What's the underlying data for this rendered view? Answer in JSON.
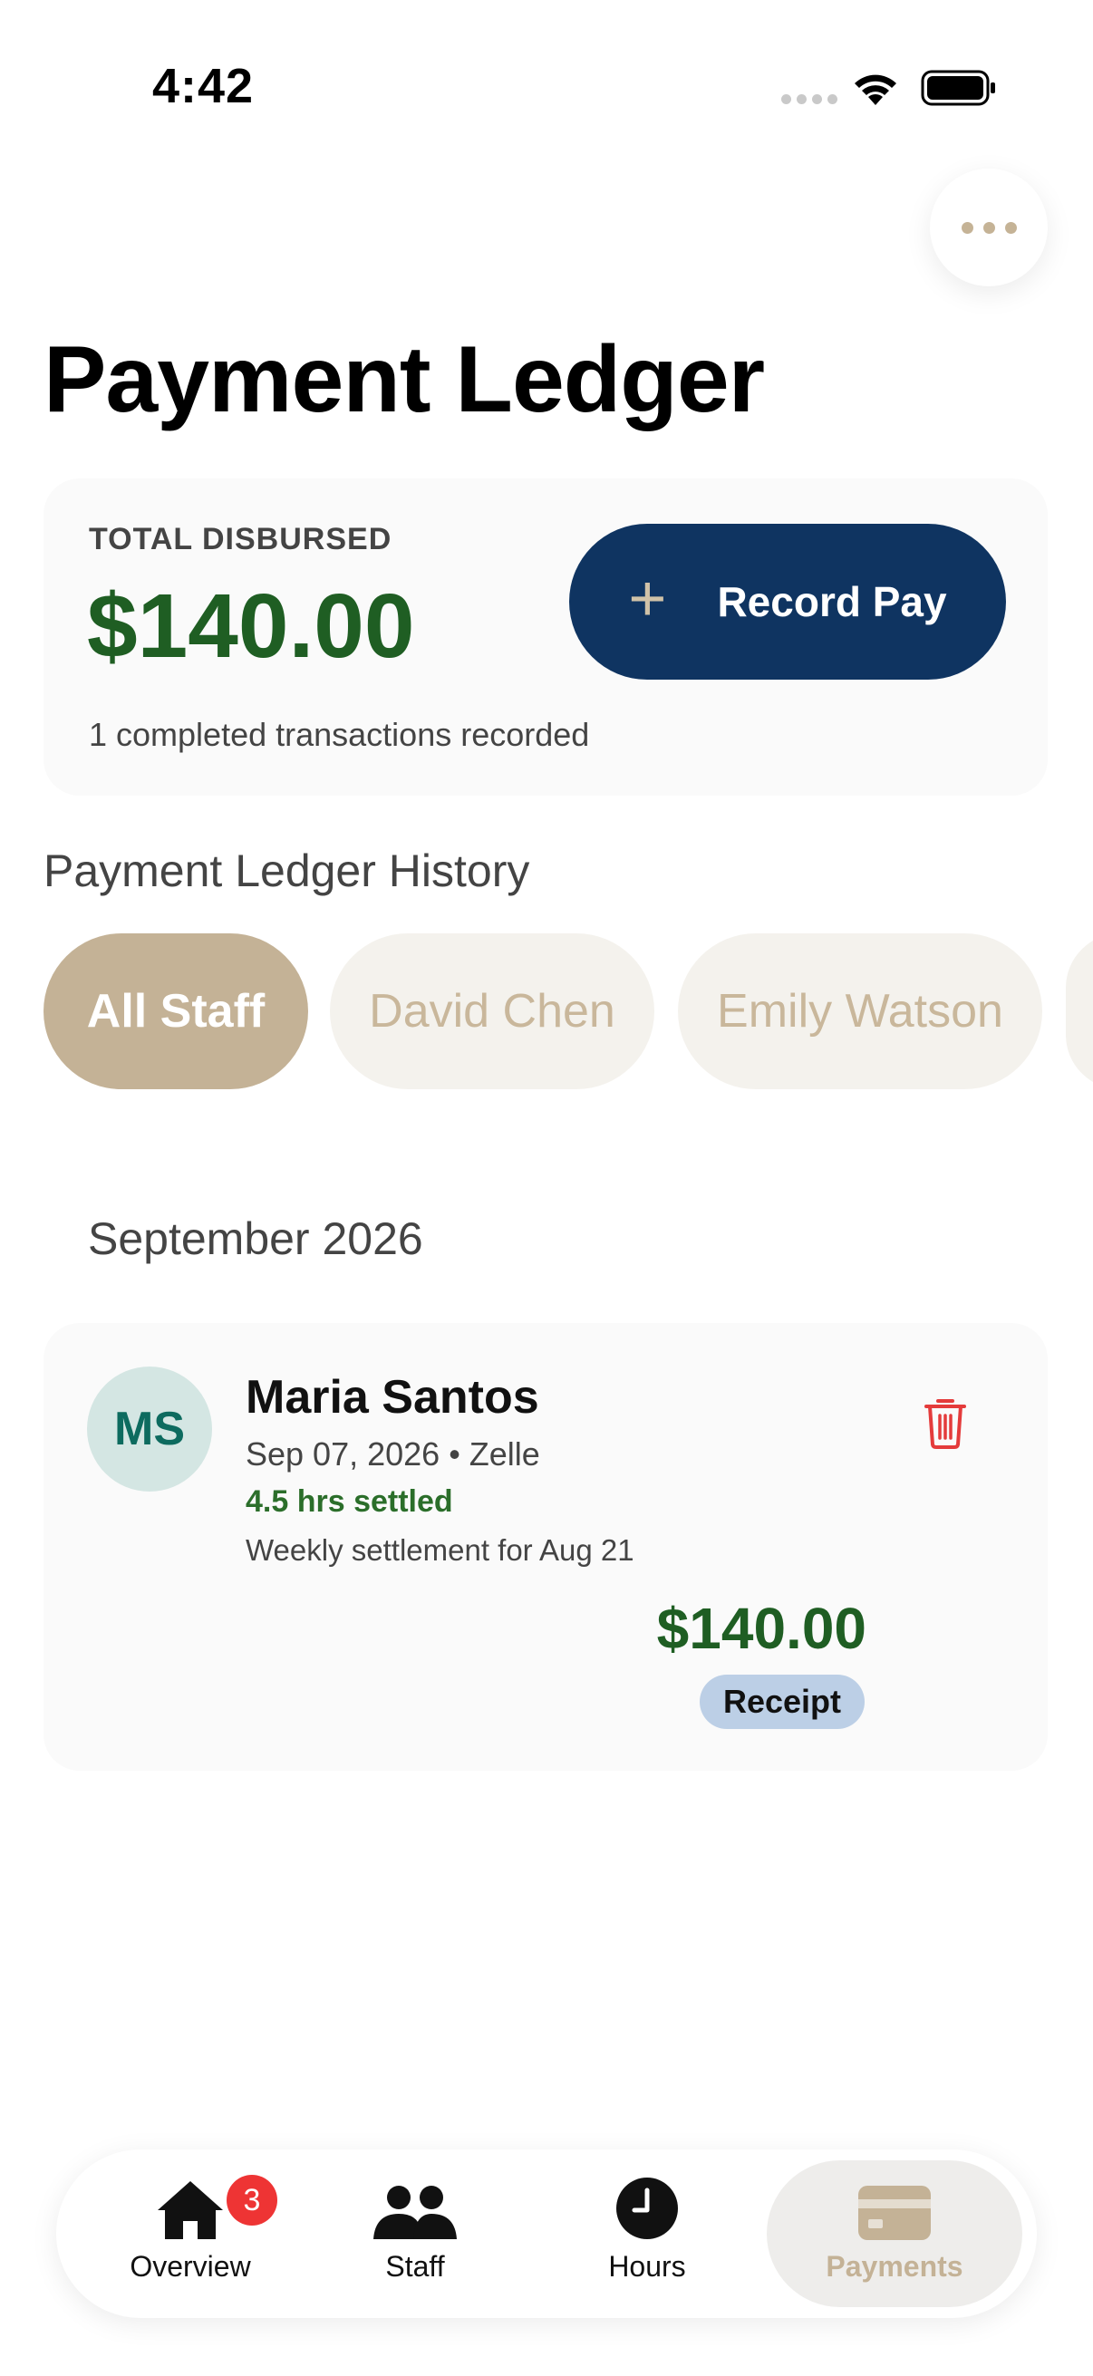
{
  "status_bar": {
    "time": "4:42"
  },
  "page": {
    "title": "Payment Ledger"
  },
  "summary": {
    "label": "TOTAL DISBURSED",
    "amount": "$140.00",
    "note": "1 completed transactions recorded",
    "record_button_label": "Record Pay"
  },
  "history": {
    "title": "Payment Ledger History",
    "filters": [
      {
        "label": "All Staff",
        "active": true
      },
      {
        "label": "David Chen",
        "active": false
      },
      {
        "label": "Emily Watson",
        "active": false
      }
    ],
    "month": "September 2026",
    "transactions": [
      {
        "initials": "MS",
        "name": "Maria Santos",
        "date": "Sep 07, 2026",
        "method": "Zelle",
        "meta": "Sep 07, 2026 • Zelle",
        "hours": "4.5 hrs settled",
        "description": "Weekly settlement for Aug 21",
        "amount": "$140.00",
        "badge": "Receipt"
      }
    ]
  },
  "tabs": [
    {
      "label": "Overview",
      "icon": "home-icon",
      "badge": "3",
      "active": false
    },
    {
      "label": "Staff",
      "icon": "people-icon",
      "active": false
    },
    {
      "label": "Hours",
      "icon": "clock-icon",
      "active": false
    },
    {
      "label": "Payments",
      "icon": "card-icon",
      "active": true
    }
  ],
  "colors": {
    "accent_tan": "#c4b296",
    "navy": "#0f3461",
    "money_green": "#1f5e23",
    "danger_red": "#ee3434"
  }
}
